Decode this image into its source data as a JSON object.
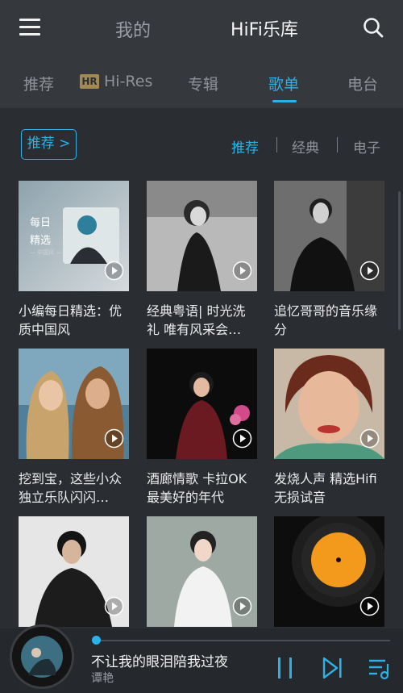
{
  "header": {
    "mine_label": "我的",
    "library_label": "HiFi乐库",
    "icons": [
      "menu-icon",
      "search-icon"
    ]
  },
  "tabs": [
    {
      "label": "推荐",
      "active": false
    },
    {
      "badge": "HR",
      "label": "Hi-Res",
      "active": false
    },
    {
      "label": "专辑",
      "active": false
    },
    {
      "label": "歌单",
      "active": true
    },
    {
      "label": "电台",
      "active": false
    }
  ],
  "filter": {
    "recommend_button": "推荐 >",
    "options": [
      {
        "label": "推荐",
        "active": true
      },
      {
        "label": "经典",
        "active": false
      },
      {
        "label": "电子",
        "active": false
      }
    ]
  },
  "playlists": [
    {
      "title": "小编每日精选：优质中国风",
      "cover_text": "每日\n精选",
      "cover_sub": "— 中国风 —"
    },
    {
      "title": "经典粤语| 时光洗礼 唯有风采会…"
    },
    {
      "title": "追忆哥哥的音乐缘分"
    },
    {
      "title": "挖到宝，这些小众独立乐队闪闪…"
    },
    {
      "title": "酒廊情歌 卡拉OK 最美好的年代"
    },
    {
      "title": "发烧人声 精选Hifi无损试音"
    },
    {
      "title": ""
    },
    {
      "title": ""
    },
    {
      "title": ""
    }
  ],
  "player": {
    "song_title": "不让我的眼泪陪我过夜",
    "artist": "谭艳",
    "progress": 0.01
  },
  "colors": {
    "accent": "#2bb2e6",
    "background": "#2a2d32",
    "header": "#35383d",
    "hr_badge": "#a38a55"
  }
}
